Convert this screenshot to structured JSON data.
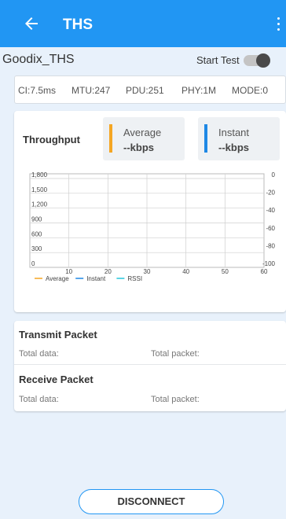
{
  "appbar": {
    "title": "THS",
    "back_icon": "arrow-left-icon",
    "menu_icon": "more-vert-icon"
  },
  "device": {
    "name": "Goodix_THS",
    "start_test_label": "Start Test",
    "start_test_on": false
  },
  "params": {
    "ci": "CI:7.5ms",
    "mtu": "MTU:247",
    "pdu": "PDU:251",
    "phy": "PHY:1M",
    "mode": "MODE:0"
  },
  "throughput": {
    "label": "Throughput",
    "average": {
      "label": "Average",
      "value": "--kbps",
      "color": "#f5a623"
    },
    "instant": {
      "label": "Instant",
      "value": "--kbps",
      "color": "#1e88e5"
    }
  },
  "chart_data": {
    "type": "line",
    "x_ticks": [
      "10",
      "20",
      "30",
      "40",
      "50",
      "60"
    ],
    "xlim": [
      0,
      60
    ],
    "y_left_ticks": [
      "1,800",
      "1,500",
      "1,200",
      "900",
      "600",
      "300",
      "0"
    ],
    "ylim_left": [
      0,
      1800
    ],
    "y_right_ticks": [
      "0",
      "-20",
      "-40",
      "-60",
      "-80",
      "-100"
    ],
    "ylim_right": [
      -100,
      0
    ],
    "grid": true,
    "legend_position": "bottom-left",
    "series": [
      {
        "name": "Average",
        "color": "#f5a623",
        "values": []
      },
      {
        "name": "Instant",
        "color": "#1e88e5",
        "values": []
      },
      {
        "name": "RSSI",
        "color": "#26c6da",
        "values": []
      }
    ]
  },
  "transmit": {
    "title": "Transmit Packet",
    "total_data_label": "Total data:",
    "total_packet_label": "Total packet:"
  },
  "receive": {
    "title": "Receive Packet",
    "total_data_label": "Total data:",
    "total_packet_label": "Total packet:"
  },
  "disconnect_label": "DISCONNECT"
}
